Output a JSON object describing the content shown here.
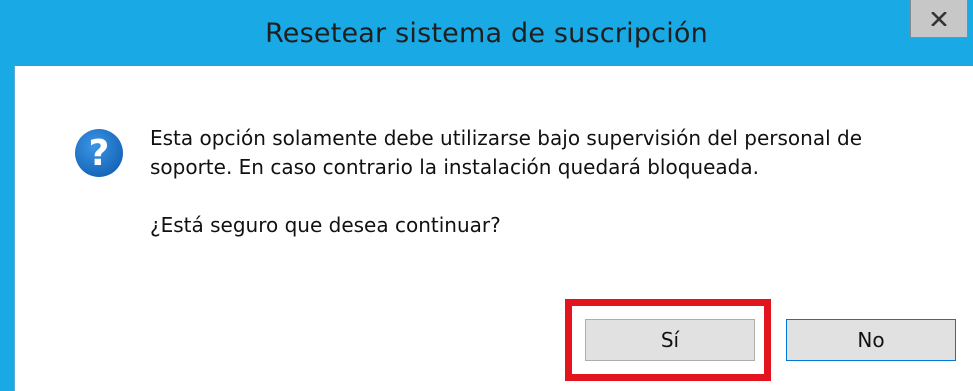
{
  "dialog": {
    "title": "Resetear sistema de suscripción",
    "close_label": "x",
    "icon": "question-icon",
    "message_line1": "Esta opción solamente debe utilizarse bajo supervisión del personal de",
    "message_line2": "soporte. En caso contrario la instalación quedará bloqueada.",
    "question": "¿Está seguro que desea continuar?",
    "buttons": {
      "yes_label": "Sí",
      "no_label": "No"
    }
  },
  "colors": {
    "titlebar": "#19a9e5",
    "highlight": "#e3141e",
    "icon_blue": "#1a72c7"
  }
}
